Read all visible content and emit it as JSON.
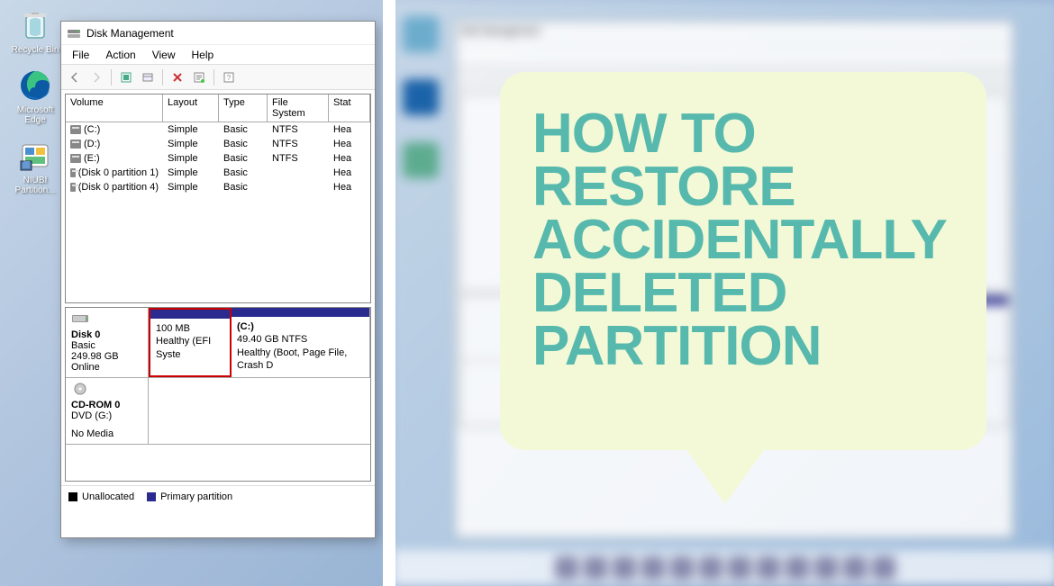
{
  "desktop_icons": [
    {
      "name": "recycle-bin",
      "label": "Recycle Bin"
    },
    {
      "name": "ms-edge",
      "label": "Microsoft Edge"
    },
    {
      "name": "niubi",
      "label": "NIUBI Partition..."
    }
  ],
  "window": {
    "title": "Disk Management",
    "menu": [
      "File",
      "Action",
      "View",
      "Help"
    ]
  },
  "vol_header": {
    "volume": "Volume",
    "layout": "Layout",
    "type": "Type",
    "fs": "File System",
    "status": "Stat"
  },
  "volumes": [
    {
      "name": "(C:)",
      "layout": "Simple",
      "type": "Basic",
      "fs": "NTFS",
      "status": "Hea"
    },
    {
      "name": "(D:)",
      "layout": "Simple",
      "type": "Basic",
      "fs": "NTFS",
      "status": "Hea"
    },
    {
      "name": "(E:)",
      "layout": "Simple",
      "type": "Basic",
      "fs": "NTFS",
      "status": "Hea"
    },
    {
      "name": "(Disk 0 partition 1)",
      "layout": "Simple",
      "type": "Basic",
      "fs": "",
      "status": "Hea"
    },
    {
      "name": "(Disk 0 partition 4)",
      "layout": "Simple",
      "type": "Basic",
      "fs": "",
      "status": "Hea"
    }
  ],
  "disk0": {
    "name": "Disk 0",
    "type": "Basic",
    "size": "249.98 GB",
    "status": "Online",
    "p100_size": "100 MB",
    "p100_status": "Healthy (EFI Syste",
    "pc_name": "(C:)",
    "pc_size": "49.40 GB NTFS",
    "pc_status": "Healthy (Boot, Page File, Crash D"
  },
  "cdrom": {
    "name": "CD-ROM 0",
    "drive": "DVD (G:)",
    "media": "No Media"
  },
  "legend": {
    "unalloc": "Unallocated",
    "primary": "Primary partition"
  },
  "callout": "How to Restore Accidentally Deleted Partition"
}
